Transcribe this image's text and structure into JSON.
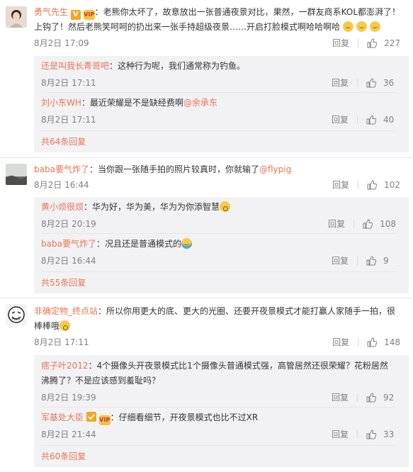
{
  "colors": {
    "link": "#eb7350",
    "meta": "#808080",
    "sub_bg": "#f2f2f5"
  },
  "labels": {
    "reply": "回复"
  },
  "threads": [
    {
      "user": "勇气先生",
      "text_line1": "：老熊你太坏了，故意放出一张普通夜景对比，果然，一群友商系KOL都澎湃了！",
      "text_line2": "上钩了！然后老熊笑呵呵的扔出来一张手持超级夜景……开启打脸模式啊哈哈啊哈",
      "date": "8月2日 17:09",
      "likes": "227",
      "replies": [
        {
          "user": "还是叫我长青哥吧",
          "text": "：这种行为呢，我们通常称为钓鱼。",
          "date": "8月2日 17:11",
          "likes": "36"
        },
        {
          "user": "刘小东WH",
          "text": "：最近荣耀是不是缺经费啊",
          "mention": "@余承东",
          "date": "8月2日 17:11",
          "likes": "40"
        }
      ],
      "more": "共64条回复"
    },
    {
      "user": "baba要气炸了",
      "text": "：当你跟一张随手拍的照片较真时，你就输了",
      "mention": "@flypig",
      "date": "8月2日 16:44",
      "likes": "102",
      "replies": [
        {
          "user": "黄小烦很烦",
          "text": "：华为好，华为美，华为为你添智慧",
          "date": "8月2日 20:19",
          "likes": "108"
        },
        {
          "user": "baba要气炸了",
          "text": "：况且还是普通模式的",
          "date": "8月2日 16:44",
          "likes": "9"
        }
      ],
      "more": "共55条回复"
    },
    {
      "user": "非确定物_终点站",
      "text_line1": "：所以你用更大的底、更大的光圈、还要开夜景模式才能打赢人家随手一拍，很",
      "text_line2": "棒棒哦",
      "date": "8月2日 17:11",
      "likes": "148",
      "replies": [
        {
          "user": "痞子叶2012",
          "text_line1": "：4个摄像头开夜景模式比1个摄像头普通模式强，高管居然还很荣耀？花粉居然",
          "text_line2": "沸腾了？不是应该感到羞耻吗？",
          "date": "8月2日 19:39",
          "likes": "92"
        },
        {
          "user": "军基处大臣",
          "text": "：仔细看细节，开夜景模式也比不过XR",
          "date": "8月2日 21:44",
          "likes": "33"
        }
      ],
      "more": "共60条回复"
    }
  ]
}
